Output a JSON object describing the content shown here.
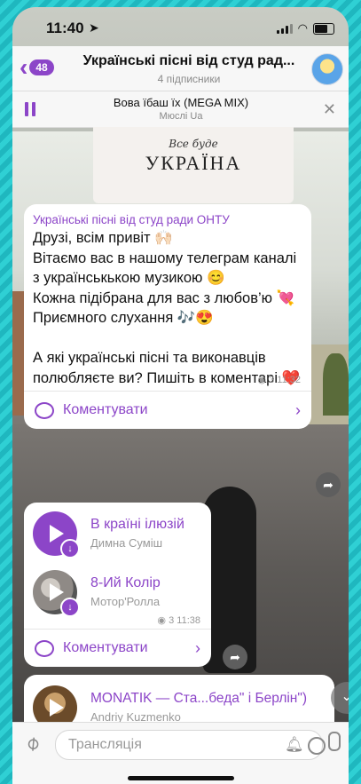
{
  "status": {
    "time": "11:40"
  },
  "header": {
    "back_count": "48",
    "title": "Українські пісні від студ рад...",
    "subtitle": "4 підписники"
  },
  "player": {
    "title": "Вова їбаш їх (MEGA MIX)",
    "artist": "Мюслі Ua"
  },
  "image_card": {
    "script_text": "Все буде",
    "big_text": "УКРАЇНА"
  },
  "post": {
    "sender": "Українські пісні від студ ради ОНТУ",
    "text": "Друзі, всім привіт 🙌🏻\nВітаємо вас в нашому телеграм каналі з українськькою музикою 😊\nКожна підібрана для вас з любов’ю 💘\nПриємного слухання 🎶😍\n\nА які українські пісні та виконавців полюбляєте ви? Пишіть в коментарі ❤️",
    "views": "3",
    "time": "11:32",
    "comment_label": "Коментувати"
  },
  "music_post": {
    "tracks": [
      {
        "title": "В країні ілюзій",
        "artist": "Димна Суміш"
      },
      {
        "title": "8-Ий Колір",
        "artist": "Мотор'Ролла"
      }
    ],
    "views": "3",
    "time": "11:38",
    "comment_label": "Коментувати"
  },
  "third_post": {
    "title": "MONATIK — Ста...беда\" і Берлін\")",
    "artist": "Andriy Kuzmenko"
  },
  "input": {
    "placeholder": "Трансляція"
  },
  "colors": {
    "accent": "#8c45c8",
    "background_frame": "#2fd0d4"
  }
}
